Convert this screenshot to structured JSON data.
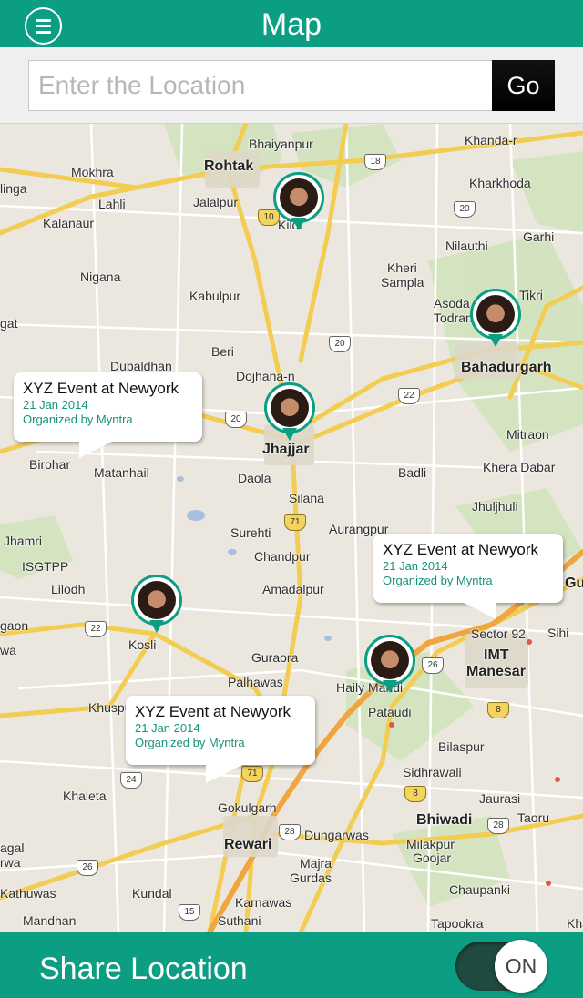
{
  "header": {
    "title": "Map"
  },
  "search": {
    "placeholder": "Enter the Location",
    "go_label": "Go"
  },
  "map": {
    "places": [
      {
        "name": "Rohtak",
        "big": true
      },
      {
        "name": "Bhaiyanpur"
      },
      {
        "name": "Khanda-r"
      },
      {
        "name": "Mokhra"
      },
      {
        "name": "Kharkhoda"
      },
      {
        "name": "linga"
      },
      {
        "name": "Lahli"
      },
      {
        "name": "Jalalpur"
      },
      {
        "name": "Kiloi"
      },
      {
        "name": "Kalanaur"
      },
      {
        "name": "Garhi"
      },
      {
        "name": "Nilauthi"
      },
      {
        "name": "Nigana"
      },
      {
        "name": "Kheri"
      },
      {
        "name": "Sampla"
      },
      {
        "name": "Kabulpur"
      },
      {
        "name": "Asoda"
      },
      {
        "name": "Todran"
      },
      {
        "name": "Tikri"
      },
      {
        "name": "gat"
      },
      {
        "name": "Beri"
      },
      {
        "name": "Bahadurgarh",
        "big": true
      },
      {
        "name": "Dubaldhan"
      },
      {
        "name": "Dojhana-n"
      },
      {
        "name": "Jhajjar",
        "big": true
      },
      {
        "name": "Mitraon"
      },
      {
        "name": "Birohar"
      },
      {
        "name": "Matanhail"
      },
      {
        "name": "Daola"
      },
      {
        "name": "Khera Dabar"
      },
      {
        "name": "Badli"
      },
      {
        "name": "Silana"
      },
      {
        "name": "Jhuljhuli"
      },
      {
        "name": "Jhamri"
      },
      {
        "name": "Surehti"
      },
      {
        "name": "Aurangpur"
      },
      {
        "name": "ISGTPP"
      },
      {
        "name": "Chandpur"
      },
      {
        "name": "Lilodh"
      },
      {
        "name": "Amadalpur"
      },
      {
        "name": "Gu"
      },
      {
        "name": "gaon"
      },
      {
        "name": "Sector 92"
      },
      {
        "name": "Sihi"
      },
      {
        "name": "Kosli"
      },
      {
        "name": "Guraora"
      },
      {
        "name": "IMT"
      },
      {
        "name": "Manesar"
      },
      {
        "name": "wa"
      },
      {
        "name": "Palhawas"
      },
      {
        "name": "Haily Mandi"
      },
      {
        "name": "Khuspura"
      },
      {
        "name": "Pataudi"
      },
      {
        "name": "Bilaspur"
      },
      {
        "name": "Sidhrawali"
      },
      {
        "name": "Khaleta"
      },
      {
        "name": "Jaurasi"
      },
      {
        "name": "Gokulgarh"
      },
      {
        "name": "Bhiwadi",
        "big": true
      },
      {
        "name": "Taoru"
      },
      {
        "name": "Dungarwas"
      },
      {
        "name": "Rewari",
        "big": true
      },
      {
        "name": "Milakpur"
      },
      {
        "name": "Goojar"
      },
      {
        "name": "Majra"
      },
      {
        "name": "Gurdas"
      },
      {
        "name": "agal"
      },
      {
        "name": "rwa"
      },
      {
        "name": "Kathuwas"
      },
      {
        "name": "Kundal"
      },
      {
        "name": "Chaupanki"
      },
      {
        "name": "Karnawas"
      },
      {
        "name": "Mandhan"
      },
      {
        "name": "Suthani"
      },
      {
        "name": "Tapookra"
      },
      {
        "name": "Khanpur"
      }
    ],
    "shields": [
      {
        "num": "18"
      },
      {
        "num": "10",
        "yellow": true
      },
      {
        "num": "20"
      },
      {
        "num": "20"
      },
      {
        "num": "22"
      },
      {
        "num": "20"
      },
      {
        "num": "71",
        "yellow": true
      },
      {
        "num": "22"
      },
      {
        "num": "26"
      },
      {
        "num": "8",
        "yellow": true
      },
      {
        "num": "24"
      },
      {
        "num": "71",
        "yellow": true
      },
      {
        "num": "8",
        "yellow": true
      },
      {
        "num": "28"
      },
      {
        "num": "28"
      },
      {
        "num": "26"
      },
      {
        "num": "15"
      }
    ],
    "events": [
      {
        "title": "XYZ Event at Newyork",
        "date": "21 Jan 2014",
        "org": "Organized by Myntra"
      },
      {
        "title": "XYZ Event at Newyork",
        "date": "21 Jan 2014",
        "org": "Organized by Myntra"
      },
      {
        "title": "XYZ Event at Newyork",
        "date": "21 Jan 2014",
        "org": "Organized by Myntra"
      }
    ],
    "pins_count_note": "user-avatar"
  },
  "footer": {
    "label": "Share Location",
    "toggle_label": "ON"
  },
  "colors": {
    "accent": "#0b9e82",
    "toggle_track": "#1f4a40"
  }
}
